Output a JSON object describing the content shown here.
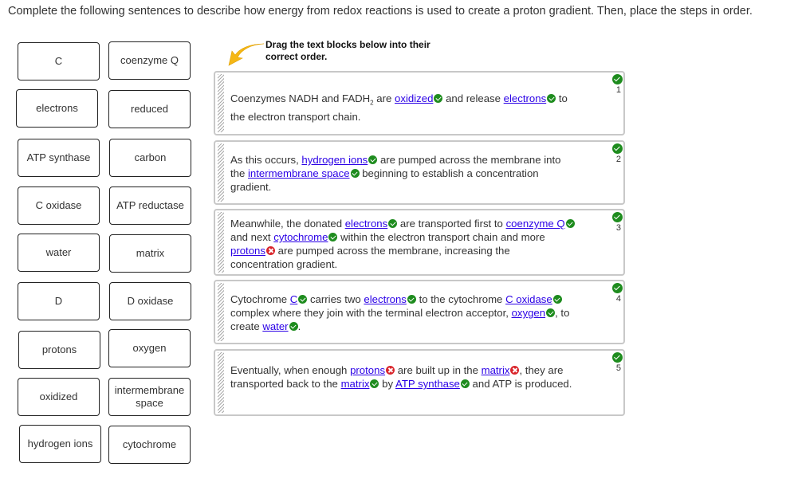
{
  "instructions": "Complete the following sentences to describe how energy from redox reactions is used to create a proton gradient. Then, place the steps in order.",
  "hint": "Drag the text blocks below into their correct order.",
  "word_bank": [
    [
      "C",
      "coenzyme Q"
    ],
    [
      "electrons",
      "reduced"
    ],
    [
      "ATP synthase",
      "carbon"
    ],
    [
      "C oxidase",
      "ATP reductase"
    ],
    [
      "water",
      "matrix"
    ],
    [
      "D",
      "D oxidase"
    ],
    [
      "protons",
      "oxygen"
    ],
    [
      "oxidized",
      "intermembrane space"
    ],
    [
      "hydrogen ions",
      "cytochrome"
    ]
  ],
  "colors": {
    "correct": "#1e8c1e",
    "incorrect": "#d9262c",
    "blank_link": "#2a00e6"
  },
  "blocks": [
    {
      "order": "1",
      "status": "correct",
      "segments": [
        {
          "t": "Coenzymes NADH and FADH"
        },
        {
          "sub": "2"
        },
        {
          "t": " are "
        },
        {
          "blank": "oxidized",
          "mark": "correct"
        },
        {
          "t": " and release "
        },
        {
          "blank": "electrons",
          "mark": "correct"
        },
        {
          "t": " to the electron transport chain."
        }
      ]
    },
    {
      "order": "2",
      "status": "correct",
      "segments": [
        {
          "t": "As this occurs, "
        },
        {
          "blank": "hydrogen ions",
          "mark": "correct"
        },
        {
          "t": " are pumped across the membrane into the "
        },
        {
          "blank": "intermembrane space",
          "mark": "correct"
        },
        {
          "t": " beginning to establish a concentration gradient."
        }
      ]
    },
    {
      "order": "3",
      "status": "correct",
      "segments": [
        {
          "t": "Meanwhile, the donated "
        },
        {
          "blank": "electrons",
          "mark": "correct"
        },
        {
          "t": " are transported first to "
        },
        {
          "blank": "coenzyme Q",
          "mark": "correct"
        },
        {
          "t": " and next "
        },
        {
          "blank": "cytochrome",
          "mark": "correct"
        },
        {
          "t": " within the electron transport chain and more "
        },
        {
          "blank": "protons",
          "mark": "incorrect"
        },
        {
          "t": " are pumped across the membrane, increasing the concentration gradient."
        }
      ]
    },
    {
      "order": "4",
      "status": "correct",
      "segments": [
        {
          "t": "Cytochrome "
        },
        {
          "blank": "C",
          "mark": "correct"
        },
        {
          "t": " carries two "
        },
        {
          "blank": "electrons",
          "mark": "correct"
        },
        {
          "t": " to the cytochrome "
        },
        {
          "blank": "C oxidase",
          "mark": "correct"
        },
        {
          "t": " complex where they join with the terminal electron acceptor, "
        },
        {
          "blank": "oxygen",
          "mark": "correct"
        },
        {
          "t": ", to create "
        },
        {
          "blank": "water",
          "mark": "correct"
        },
        {
          "t": "."
        }
      ]
    },
    {
      "order": "5",
      "status": "correct",
      "segments": [
        {
          "t": "Eventually, when enough "
        },
        {
          "blank": "protons",
          "mark": "incorrect"
        },
        {
          "t": " are built up in the "
        },
        {
          "blank": "matrix",
          "mark": "incorrect"
        },
        {
          "t": ", they are transported back to the "
        },
        {
          "blank": "matrix",
          "mark": "correct"
        },
        {
          "t": " by "
        },
        {
          "blank": "ATP synthase",
          "mark": "correct"
        },
        {
          "t": " and ATP is produced."
        }
      ]
    }
  ]
}
